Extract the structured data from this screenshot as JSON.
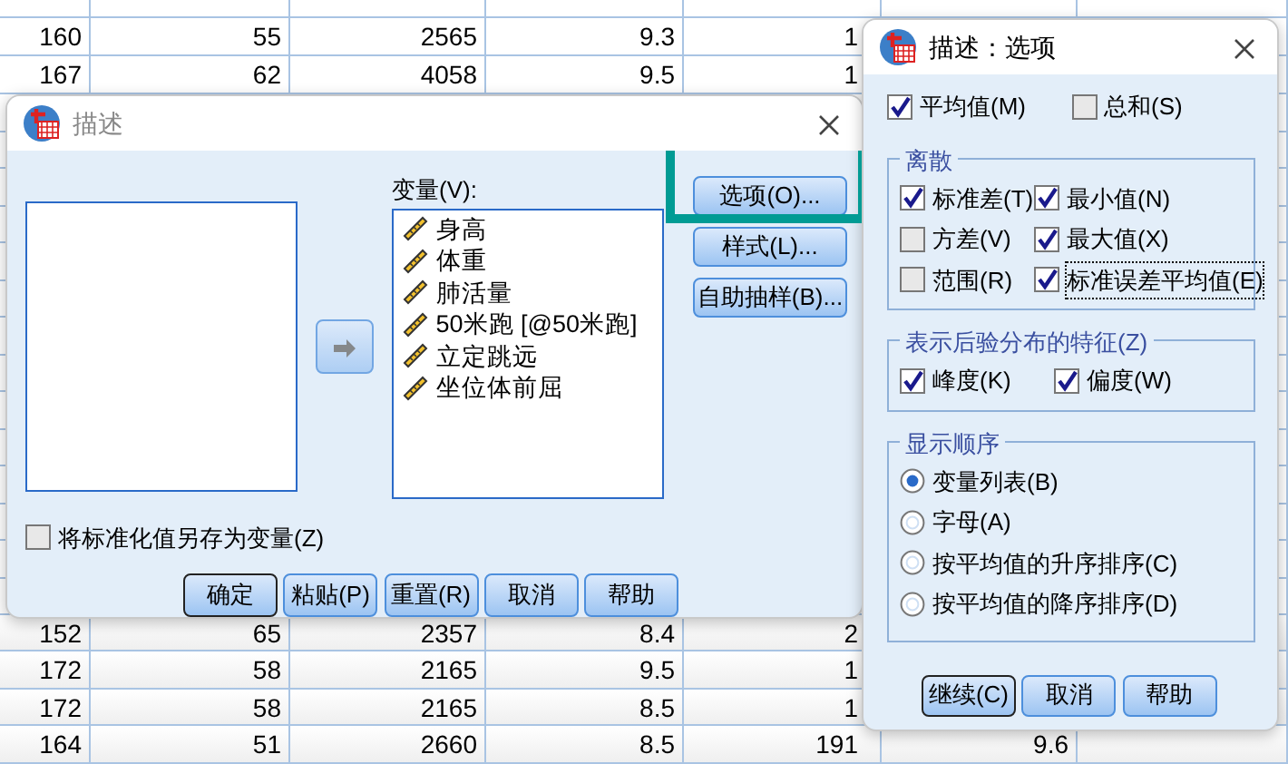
{
  "data_table": {
    "upper_rows": [
      {
        "cells": [
          "160",
          "55",
          "2565",
          "9.3",
          "1"
        ]
      },
      {
        "cells": [
          "167",
          "62",
          "4058",
          "9.5",
          "1"
        ]
      }
    ],
    "lower_rows": [
      {
        "cells": [
          "152",
          "65",
          "2357",
          "8.4",
          "2"
        ]
      },
      {
        "cells": [
          "172",
          "58",
          "2165",
          "9.5",
          "1"
        ]
      },
      {
        "cells": [
          "172",
          "58",
          "2165",
          "8.5",
          "1"
        ]
      },
      {
        "cells": [
          "164",
          "51",
          "2660",
          "8.5",
          "191",
          "9.6"
        ]
      }
    ]
  },
  "main_dialog": {
    "title": "描述",
    "target_label": "变量(V):",
    "variables": [
      {
        "name": "身高"
      },
      {
        "name": "体重"
      },
      {
        "name": "肺活量"
      },
      {
        "name": "50米跑 [@50米跑]"
      },
      {
        "name": "立定跳远"
      },
      {
        "name": "坐位体前屈"
      }
    ],
    "side_buttons": [
      {
        "label": "选项(O)...",
        "highlighted": true
      },
      {
        "label": "样式(L)...",
        "highlighted": false
      },
      {
        "label": "自助抽样(B)...",
        "highlighted": false
      }
    ],
    "save_checkbox": {
      "label": "将标准化值另存为变量(Z)",
      "checked": false
    },
    "buttons": [
      {
        "label": "确定",
        "default": true
      },
      {
        "label": "粘贴(P)",
        "default": false
      },
      {
        "label": "重置(R)",
        "default": false
      },
      {
        "label": "取消",
        "default": false
      },
      {
        "label": "帮助",
        "default": false
      }
    ]
  },
  "options_dialog": {
    "title": "描述：选项",
    "top_options": [
      {
        "label": "平均值(M)",
        "checked": true
      },
      {
        "label": "总和(S)",
        "checked": false
      }
    ],
    "dispersion": {
      "title": "离散",
      "options": [
        {
          "label": "标准差(T)",
          "checked": true,
          "focused": false
        },
        {
          "label": "最小值(N)",
          "checked": true,
          "focused": false
        },
        {
          "label": "方差(V)",
          "checked": false,
          "focused": false
        },
        {
          "label": "最大值(X)",
          "checked": true,
          "focused": false
        },
        {
          "label": "范围(R)",
          "checked": false,
          "focused": false
        },
        {
          "label": "标准误差平均值(E)",
          "checked": true,
          "focused": true
        }
      ]
    },
    "distribution": {
      "title": "表示后验分布的特征(Z)",
      "options": [
        {
          "label": "峰度(K)",
          "checked": true
        },
        {
          "label": "偏度(W)",
          "checked": true
        }
      ]
    },
    "display_order": {
      "title": "显示顺序",
      "options": [
        {
          "label": "变量列表(B)",
          "selected": true
        },
        {
          "label": "字母(A)",
          "selected": false
        },
        {
          "label": "按平均值的升序排序(C)",
          "selected": false
        },
        {
          "label": "按平均值的降序排序(D)",
          "selected": false
        }
      ]
    },
    "buttons": [
      {
        "label": "继续(C)",
        "default": true
      },
      {
        "label": "取消",
        "default": false
      },
      {
        "label": "帮助",
        "default": false
      }
    ]
  }
}
